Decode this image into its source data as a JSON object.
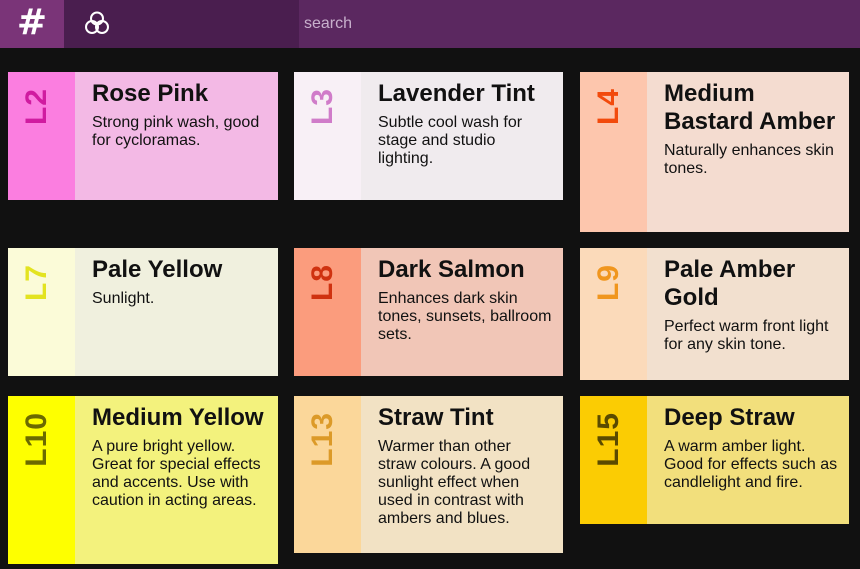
{
  "header": {
    "menu_symbol": "#",
    "logo_icon": "filter-circles-icon",
    "search_placeholder": "search"
  },
  "filters": [
    {
      "code": "L2",
      "name": "Rose Pink",
      "description": "Strong pink wash, good for cycloramas.",
      "swatch_color": "#fb7ee0",
      "code_color": "#d01ba0",
      "body_color": "#f3b9e5"
    },
    {
      "code": "L3",
      "name": "Lavender Tint",
      "description": "Subtle cool wash for stage and studio lighting.",
      "swatch_color": "#f8f0f6",
      "code_color": "#d07cc9",
      "body_color": "#f0ebee"
    },
    {
      "code": "L4",
      "name": "Medium Bastard Amber",
      "description": "Naturally enhances skin tones.",
      "swatch_color": "#fdc6ad",
      "code_color": "#f24a0c",
      "body_color": "#f4dcd0"
    },
    {
      "code": "L7",
      "name": "Pale Yellow",
      "description": "Sunlight.",
      "swatch_color": "#fbfbd8",
      "code_color": "#e3e320",
      "body_color": "#f0f0de"
    },
    {
      "code": "L8",
      "name": "Dark Salmon",
      "description": "Enhances dark skin tones, sunsets, ballroom sets.",
      "swatch_color": "#fb9c7d",
      "code_color": "#cf3210",
      "body_color": "#f1c6b7"
    },
    {
      "code": "L9",
      "name": "Pale Amber Gold",
      "description": "Perfect warm front light for any skin tone.",
      "swatch_color": "#fbdaba",
      "code_color": "#f0961e",
      "body_color": "#f2e0cf"
    },
    {
      "code": "L10",
      "name": "Medium Yellow",
      "description": "A pure bright yellow. Great for special effects and accents. Use with caution in acting areas.",
      "swatch_color": "#feff00",
      "code_color": "#6b6a00",
      "body_color": "#f3f27d"
    },
    {
      "code": "L13",
      "name": "Straw Tint",
      "description": "Warmer than other straw colours. A good sunlight effect when used in contrast with ambers and blues.",
      "swatch_color": "#fbd79a",
      "code_color": "#dc9a28",
      "body_color": "#f2e2c4"
    },
    {
      "code": "L15",
      "name": "Deep Straw",
      "description": "A warm amber light. Good for effects such as candlelight and fire.",
      "swatch_color": "#fbcc03",
      "code_color": "#5a4a00",
      "body_color": "#f2df7c"
    }
  ]
}
